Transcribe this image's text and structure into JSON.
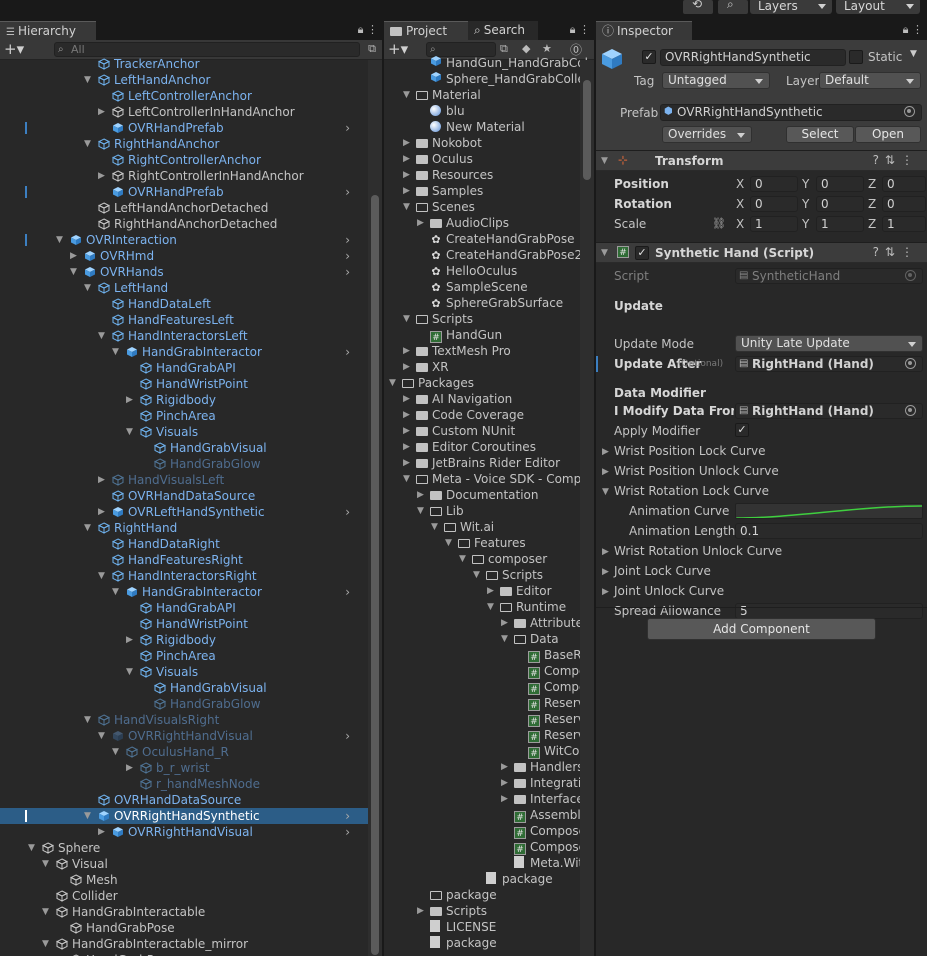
{
  "topbar": {
    "layers_label": "Layers",
    "layout_label": "Layout"
  },
  "hierarchy": {
    "tab_label": "Hierarchy",
    "search_placeholder": "All",
    "rows": [
      {
        "label": "TrackerAnchor",
        "style": "prefab",
        "indent": 6,
        "expand": ""
      },
      {
        "label": "LeftHandAnchor",
        "style": "prefab",
        "indent": 6,
        "expand": "open"
      },
      {
        "label": "LeftControllerAnchor",
        "style": "prefab",
        "indent": 7,
        "expand": ""
      },
      {
        "label": "LeftControllerInHandAnchor",
        "style": "plain",
        "indent": 7,
        "expand": "closed"
      },
      {
        "label": "OVRHandPrefab",
        "style": "prefab",
        "indent": 7,
        "expand": "",
        "chev": true,
        "mark": true,
        "prefabIcon": true
      },
      {
        "label": "RightHandAnchor",
        "style": "prefab",
        "indent": 6,
        "expand": "open"
      },
      {
        "label": "RightControllerAnchor",
        "style": "prefab",
        "indent": 7,
        "expand": ""
      },
      {
        "label": "RightControllerInHandAnchor",
        "style": "plain",
        "indent": 7,
        "expand": "closed"
      },
      {
        "label": "OVRHandPrefab",
        "style": "prefab",
        "indent": 7,
        "expand": "",
        "chev": true,
        "mark": true,
        "prefabIcon": true
      },
      {
        "label": "LeftHandAnchorDetached",
        "style": "plain",
        "indent": 6,
        "expand": ""
      },
      {
        "label": "RightHandAnchorDetached",
        "style": "plain",
        "indent": 6,
        "expand": ""
      },
      {
        "label": "OVRInteraction",
        "style": "prefab",
        "indent": 4,
        "expand": "open",
        "chev": true,
        "mark": true,
        "prefabIcon": true
      },
      {
        "label": "OVRHmd",
        "style": "prefab",
        "indent": 5,
        "expand": "closed",
        "chev": true,
        "prefabIcon": true
      },
      {
        "label": "OVRHands",
        "style": "prefab",
        "indent": 5,
        "expand": "open",
        "chev": true,
        "prefabIcon": true
      },
      {
        "label": "LeftHand",
        "style": "prefab",
        "indent": 6,
        "expand": "open"
      },
      {
        "label": "HandDataLeft",
        "style": "prefab",
        "indent": 7,
        "expand": ""
      },
      {
        "label": "HandFeaturesLeft",
        "style": "prefab",
        "indent": 7,
        "expand": ""
      },
      {
        "label": "HandInteractorsLeft",
        "style": "prefab",
        "indent": 7,
        "expand": "open"
      },
      {
        "label": "HandGrabInteractor",
        "style": "prefab",
        "indent": 8,
        "expand": "open",
        "chev": true,
        "prefabIcon": true
      },
      {
        "label": "HandGrabAPI",
        "style": "prefab",
        "indent": 9,
        "expand": ""
      },
      {
        "label": "HandWristPoint",
        "style": "prefab",
        "indent": 9,
        "expand": ""
      },
      {
        "label": "Rigidbody",
        "style": "prefab",
        "indent": 9,
        "expand": "closed"
      },
      {
        "label": "PinchArea",
        "style": "prefab",
        "indent": 9,
        "expand": ""
      },
      {
        "label": "Visuals",
        "style": "prefab",
        "indent": 9,
        "expand": "open"
      },
      {
        "label": "HandGrabVisual",
        "style": "prefab",
        "indent": 10,
        "expand": ""
      },
      {
        "label": "HandGrabGlow",
        "style": "prefab-dim",
        "indent": 10,
        "expand": ""
      },
      {
        "label": "HandVisualsLeft",
        "style": "prefab-dim",
        "indent": 7,
        "expand": "closed"
      },
      {
        "label": "OVRHandDataSource",
        "style": "prefab",
        "indent": 7,
        "expand": ""
      },
      {
        "label": "OVRLeftHandSynthetic",
        "style": "prefab",
        "indent": 7,
        "expand": "closed",
        "chev": true,
        "prefabIcon": true
      },
      {
        "label": "RightHand",
        "style": "prefab",
        "indent": 6,
        "expand": "open"
      },
      {
        "label": "HandDataRight",
        "style": "prefab",
        "indent": 7,
        "expand": ""
      },
      {
        "label": "HandFeaturesRight",
        "style": "prefab",
        "indent": 7,
        "expand": ""
      },
      {
        "label": "HandInteractorsRight",
        "style": "prefab",
        "indent": 7,
        "expand": "open"
      },
      {
        "label": "HandGrabInteractor",
        "style": "prefab",
        "indent": 8,
        "expand": "open",
        "chev": true,
        "prefabIcon": true
      },
      {
        "label": "HandGrabAPI",
        "style": "prefab",
        "indent": 9,
        "expand": ""
      },
      {
        "label": "HandWristPoint",
        "style": "prefab",
        "indent": 9,
        "expand": ""
      },
      {
        "label": "Rigidbody",
        "style": "prefab",
        "indent": 9,
        "expand": "closed"
      },
      {
        "label": "PinchArea",
        "style": "prefab",
        "indent": 9,
        "expand": ""
      },
      {
        "label": "Visuals",
        "style": "prefab",
        "indent": 9,
        "expand": "open"
      },
      {
        "label": "HandGrabVisual",
        "style": "prefab",
        "indent": 10,
        "expand": ""
      },
      {
        "label": "HandGrabGlow",
        "style": "prefab-dim",
        "indent": 10,
        "expand": ""
      },
      {
        "label": "HandVisualsRight",
        "style": "prefab-dim",
        "indent": 6,
        "expand": "open"
      },
      {
        "label": "OVRRightHandVisual",
        "style": "prefab-dim",
        "indent": 7,
        "expand": "open",
        "chev": true,
        "prefabIcon": true
      },
      {
        "label": "OculusHand_R",
        "style": "prefab-dim",
        "indent": 8,
        "expand": "open"
      },
      {
        "label": "b_r_wrist",
        "style": "prefab-dim",
        "indent": 9,
        "expand": "closed"
      },
      {
        "label": "r_handMeshNode",
        "style": "prefab-dim",
        "indent": 9,
        "expand": ""
      },
      {
        "label": "OVRHandDataSource",
        "style": "prefab",
        "indent": 6,
        "expand": ""
      },
      {
        "label": "OVRRightHandSynthetic",
        "style": "plain",
        "indent": 6,
        "expand": "open",
        "chev": true,
        "selected": true,
        "prefabIcon": true
      },
      {
        "label": "OVRRightHandVisual",
        "style": "prefab",
        "indent": 7,
        "expand": "closed",
        "chev": true,
        "prefabIcon": true
      },
      {
        "label": "Sphere",
        "style": "plain",
        "indent": 2,
        "expand": "open"
      },
      {
        "label": "Visual",
        "style": "plain",
        "indent": 3,
        "expand": "open"
      },
      {
        "label": "Mesh",
        "style": "plain",
        "indent": 4,
        "expand": ""
      },
      {
        "label": "Collider",
        "style": "plain",
        "indent": 3,
        "expand": ""
      },
      {
        "label": "HandGrabInteractable",
        "style": "plain",
        "indent": 3,
        "expand": "open"
      },
      {
        "label": "HandGrabPose",
        "style": "plain",
        "indent": 4,
        "expand": ""
      },
      {
        "label": "HandGrabInteractable_mirror",
        "style": "plain",
        "indent": 3,
        "expand": "open"
      },
      {
        "label": "HandGrabPose",
        "style": "plain",
        "indent": 4,
        "expand": ""
      }
    ]
  },
  "project": {
    "tab_label": "Project",
    "search_tab_label": "Search",
    "rows": [
      {
        "label": "HandGun_HandGrabCol",
        "icon": "prefab",
        "indent": 2,
        "expand": ""
      },
      {
        "label": "Sphere_HandGrabCollec",
        "icon": "prefab",
        "indent": 2,
        "expand": ""
      },
      {
        "label": "Material",
        "icon": "folder-open",
        "indent": 1,
        "expand": "open"
      },
      {
        "label": "blu",
        "icon": "material",
        "indent": 2,
        "expand": ""
      },
      {
        "label": "New Material",
        "icon": "material",
        "indent": 2,
        "expand": ""
      },
      {
        "label": "Nokobot",
        "icon": "folder",
        "indent": 1,
        "expand": "closed"
      },
      {
        "label": "Oculus",
        "icon": "folder",
        "indent": 1,
        "expand": "closed"
      },
      {
        "label": "Resources",
        "icon": "folder",
        "indent": 1,
        "expand": "closed"
      },
      {
        "label": "Samples",
        "icon": "folder",
        "indent": 1,
        "expand": "closed"
      },
      {
        "label": "Scenes",
        "icon": "folder-open",
        "indent": 1,
        "expand": "open"
      },
      {
        "label": "AudioClips",
        "icon": "folder",
        "indent": 2,
        "expand": "closed"
      },
      {
        "label": "CreateHandGrabPose",
        "icon": "scene",
        "indent": 2,
        "expand": ""
      },
      {
        "label": "CreateHandGrabPose2",
        "icon": "scene",
        "indent": 2,
        "expand": ""
      },
      {
        "label": "HelloOculus",
        "icon": "scene",
        "indent": 2,
        "expand": ""
      },
      {
        "label": "SampleScene",
        "icon": "scene",
        "indent": 2,
        "expand": ""
      },
      {
        "label": "SphereGrabSurface",
        "icon": "scene",
        "indent": 2,
        "expand": ""
      },
      {
        "label": "Scripts",
        "icon": "folder-open",
        "indent": 1,
        "expand": "open"
      },
      {
        "label": "HandGun",
        "icon": "script",
        "indent": 2,
        "expand": ""
      },
      {
        "label": "TextMesh Pro",
        "icon": "folder",
        "indent": 1,
        "expand": "closed"
      },
      {
        "label": "XR",
        "icon": "folder",
        "indent": 1,
        "expand": "closed"
      },
      {
        "label": "Packages",
        "icon": "folder-open",
        "indent": 0,
        "expand": "open"
      },
      {
        "label": "AI Navigation",
        "icon": "folder",
        "indent": 1,
        "expand": "closed"
      },
      {
        "label": "Code Coverage",
        "icon": "folder",
        "indent": 1,
        "expand": "closed"
      },
      {
        "label": "Custom NUnit",
        "icon": "folder",
        "indent": 1,
        "expand": "closed"
      },
      {
        "label": "Editor Coroutines",
        "icon": "folder",
        "indent": 1,
        "expand": "closed"
      },
      {
        "label": "JetBrains Rider Editor",
        "icon": "folder",
        "indent": 1,
        "expand": "closed"
      },
      {
        "label": "Meta - Voice SDK - Compo",
        "icon": "folder-open",
        "indent": 1,
        "expand": "open"
      },
      {
        "label": "Documentation",
        "icon": "folder",
        "indent": 2,
        "expand": "closed"
      },
      {
        "label": "Lib",
        "icon": "folder-open",
        "indent": 2,
        "expand": "open"
      },
      {
        "label": "Wit.ai",
        "icon": "folder-open",
        "indent": 3,
        "expand": "open"
      },
      {
        "label": "Features",
        "icon": "folder-open",
        "indent": 4,
        "expand": "open"
      },
      {
        "label": "composer",
        "icon": "folder-open",
        "indent": 5,
        "expand": "open"
      },
      {
        "label": "Scripts",
        "icon": "folder-open",
        "indent": 6,
        "expand": "open"
      },
      {
        "label": "Editor",
        "icon": "folder",
        "indent": 7,
        "expand": "closed"
      },
      {
        "label": "Runtime",
        "icon": "folder-open",
        "indent": 7,
        "expand": "open"
      },
      {
        "label": "Attributes",
        "icon": "folder",
        "indent": 8,
        "expand": "closed"
      },
      {
        "label": "Data",
        "icon": "folder-open",
        "indent": 8,
        "expand": "open"
      },
      {
        "label": "BaseR",
        "icon": "script",
        "indent": 9,
        "expand": ""
      },
      {
        "label": "Compo",
        "icon": "script",
        "indent": 9,
        "expand": ""
      },
      {
        "label": "Compo",
        "icon": "script",
        "indent": 9,
        "expand": ""
      },
      {
        "label": "Reserv",
        "icon": "script",
        "indent": 9,
        "expand": ""
      },
      {
        "label": "Reserv",
        "icon": "script",
        "indent": 9,
        "expand": ""
      },
      {
        "label": "Reserv",
        "icon": "script",
        "indent": 9,
        "expand": ""
      },
      {
        "label": "WitCor",
        "icon": "script",
        "indent": 9,
        "expand": ""
      },
      {
        "label": "Handlers",
        "icon": "folder",
        "indent": 8,
        "expand": "closed"
      },
      {
        "label": "Integratio",
        "icon": "folder",
        "indent": 8,
        "expand": "closed"
      },
      {
        "label": "Interface",
        "icon": "folder",
        "indent": 8,
        "expand": "closed"
      },
      {
        "label": "Assembly",
        "icon": "script",
        "indent": 8,
        "expand": ""
      },
      {
        "label": "Compose",
        "icon": "script",
        "indent": 8,
        "expand": ""
      },
      {
        "label": "Compose",
        "icon": "script",
        "indent": 8,
        "expand": ""
      },
      {
        "label": "Meta.Wit",
        "icon": "file",
        "indent": 8,
        "expand": ""
      },
      {
        "label": "package",
        "icon": "file",
        "indent": 6,
        "expand": ""
      },
      {
        "label": "package",
        "icon": "folder-open",
        "indent": 2,
        "expand": ""
      },
      {
        "label": "Scripts",
        "icon": "folder",
        "indent": 2,
        "expand": "closed"
      },
      {
        "label": "LICENSE",
        "icon": "file",
        "indent": 2,
        "expand": ""
      },
      {
        "label": "package",
        "icon": "file",
        "indent": 2,
        "expand": ""
      }
    ]
  },
  "inspector": {
    "tab_label": "Inspector",
    "object_name": "OVRRightHandSynthetic",
    "static_label": "Static",
    "tag_label": "Tag",
    "tag_value": "Untagged",
    "layer_label": "Layer",
    "layer_value": "Default",
    "prefab_label": "Prefab",
    "prefab_value": "OVRRightHandSynthetic",
    "overrides_label": "Overrides",
    "select_label": "Select",
    "open_label": "Open",
    "transform": {
      "title": "Transform",
      "position_label": "Position",
      "rotation_label": "Rotation",
      "scale_label": "Scale",
      "x": "X",
      "y": "Y",
      "z": "Z",
      "position": [
        "0",
        "0",
        "0"
      ],
      "rotation": [
        "0",
        "0",
        "0"
      ],
      "scale": [
        "1",
        "1",
        "1"
      ]
    },
    "synthetic": {
      "title": "Synthetic Hand (Script)",
      "script_label": "Script",
      "script_value": "SyntheticHand",
      "update_header": "Update",
      "update_mode_label": "Update Mode",
      "update_mode_value": "Unity Late Update",
      "update_after_label": "Update After",
      "optional_label": "(Optional)",
      "update_after_value": "RightHand (Hand)",
      "data_modifier_header": "Data Modifier",
      "modify_from_label": "I Modify Data From S",
      "modify_from_value": "RightHand (Hand)",
      "apply_modifier_label": "Apply Modifier",
      "wrist_pos_lock": "Wrist Position Lock Curve",
      "wrist_pos_unlock": "Wrist Position Unlock Curve",
      "wrist_rot_lock": "Wrist Rotation Lock Curve",
      "anim_curve_label": "Animation Curve",
      "anim_length_label": "Animation Length",
      "anim_length_value": "0.1",
      "wrist_rot_unlock": "Wrist Rotation Unlock Curve",
      "joint_lock": "Joint Lock Curve",
      "joint_unlock": "Joint Unlock Curve",
      "spread_label": "Spread Allowance",
      "spread_value": "5"
    },
    "add_component_label": "Add Component"
  },
  "colors": {
    "accent": "#2c5d87",
    "prefab_text": "#7cb3ef",
    "curve": "#3fcf3f"
  }
}
